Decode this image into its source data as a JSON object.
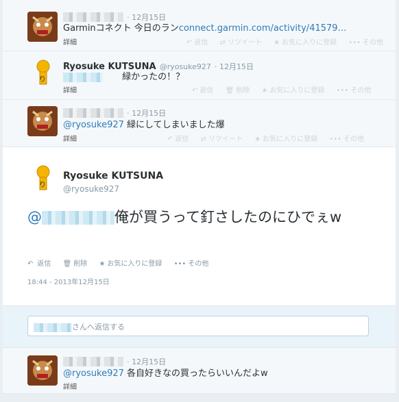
{
  "tweets": [
    {
      "date": "12月15日",
      "text": "Garminコネクト 今日のラン",
      "link": "connect.garmin.com/activity/41579…",
      "detail": "詳細"
    },
    {
      "name": "Ryosuke KUTSUNA",
      "handle": "@ryosuke927",
      "date": "12月15日",
      "text": "緑かったの！？",
      "detail": "詳細"
    },
    {
      "date": "12月15日",
      "mention": "@ryosuke927",
      "text": "緑にしてしまいました爆",
      "detail": "詳細"
    },
    {
      "date": "12月15日",
      "mention": "@ryosuke927",
      "text": "各自好きなの買ったらいいんだよw",
      "detail": "詳細"
    }
  ],
  "actions": {
    "reply": "返信",
    "retweet": "リツイート",
    "delete": "削除",
    "favorite": "お気に入りに登録",
    "more": "その他"
  },
  "main": {
    "name": "Ryosuke KUTSUNA",
    "handle": "@ryosuke927",
    "mention_prefix": "@",
    "text": "俺が買うって釘さしたのにひでぇw",
    "timestamp": "18:44 - 2013年12月15日"
  },
  "reply_box": {
    "suffix": "さんへ返信する"
  }
}
